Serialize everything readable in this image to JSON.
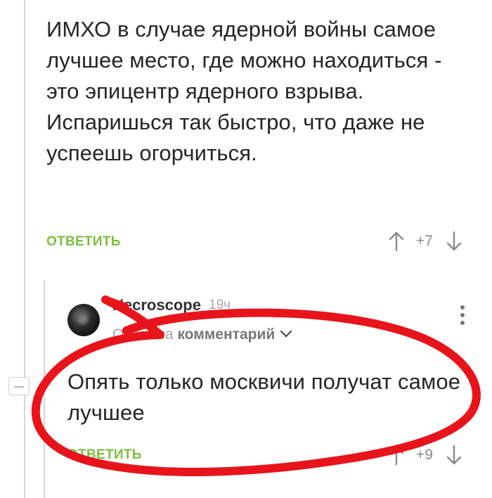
{
  "parent_comment": {
    "text": "ИМХО в случае ядерной войны самое лучшее место, где можно находиться - это эпицентр ядерного взрыва. Испаришься так быстро, что даже не успеешь огорчиться.",
    "reply_label": "ОТВЕТИТЬ",
    "rating": "+7"
  },
  "reply_comment": {
    "author": "Necroscope",
    "time": "19ч",
    "reply_to_prefix": "Ответ на",
    "reply_to_target": "комментарий",
    "text": "Опять только москвичи получат самое лучшее",
    "reply_label": "ОТВЕТИТЬ",
    "rating": "+9"
  },
  "icons": {
    "upvote": "arrow-up-icon",
    "downvote": "arrow-down-icon",
    "menu": "more-vertical-icon",
    "collapse": "minus-icon",
    "expand": "chevron-down-icon"
  },
  "colors": {
    "accent": "#7cbf3d",
    "annotation": "#e8141b"
  }
}
